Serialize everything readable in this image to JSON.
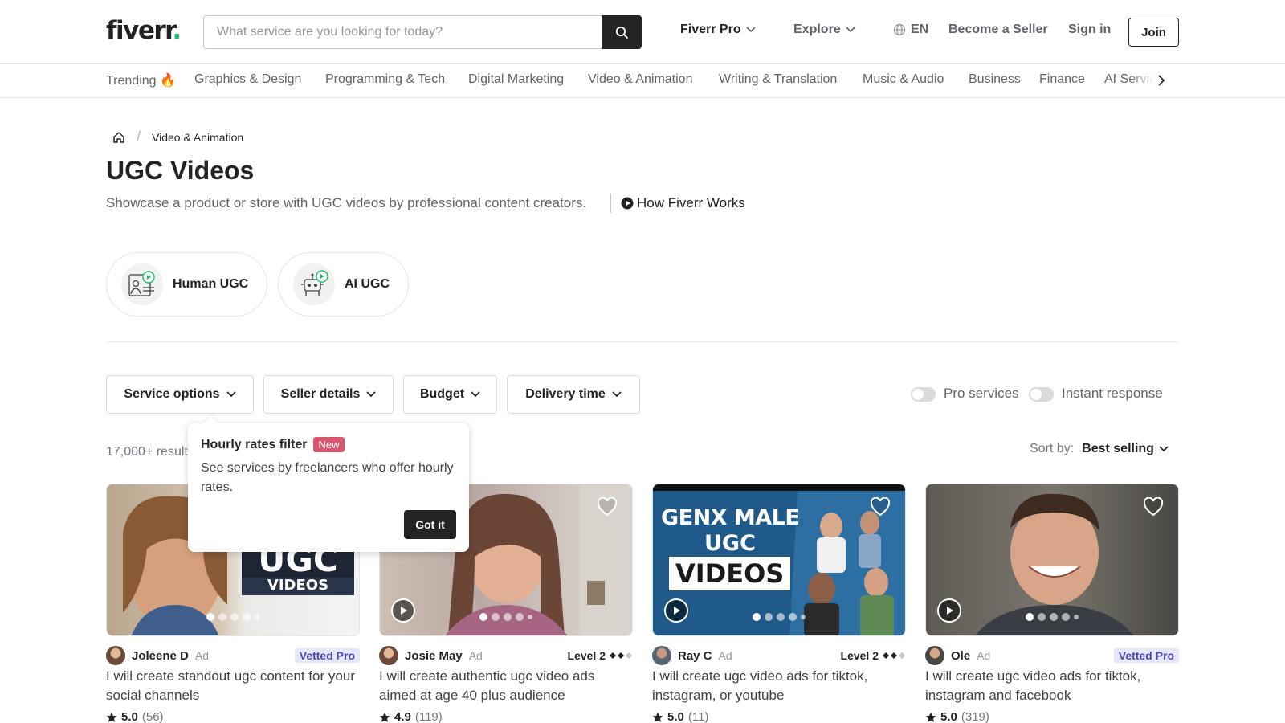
{
  "header": {
    "logo_text": "fiverr",
    "logo_dot": ".",
    "search_placeholder": "What service are you looking for today?",
    "nav": {
      "fiverr_pro": "Fiverr Pro",
      "explore": "Explore",
      "language": "EN",
      "become_seller": "Become a Seller",
      "sign_in": "Sign in",
      "join": "Join"
    }
  },
  "categories": [
    "Trending 🔥",
    "Graphics & Design",
    "Programming & Tech",
    "Digital Marketing",
    "Video & Animation",
    "Writing & Translation",
    "Music & Audio",
    "Business",
    "Finance",
    "AI Servic"
  ],
  "breadcrumb": {
    "current": "Video & Animation"
  },
  "page": {
    "title": "UGC Videos",
    "subtitle": "Showcase a product or store with UGC videos by professional content creators.",
    "how_works": "How Fiverr Works"
  },
  "subcategories": [
    "Human UGC",
    "AI UGC"
  ],
  "filters": {
    "service_options": "Service options",
    "seller_details": "Seller details",
    "budget": "Budget",
    "delivery_time": "Delivery time",
    "pro_services": "Pro services",
    "instant_response": "Instant response"
  },
  "results": {
    "count_text": "17,000+ result",
    "sort_label": "Sort by:",
    "sort_value": "Best selling"
  },
  "popover": {
    "title": "Hourly rates filter",
    "badge": "New",
    "text": "See services by freelancers who offer hourly rates.",
    "button": "Got it"
  },
  "gigs": [
    {
      "seller": "Joleene D",
      "ad": "Ad",
      "badge": "Vetted Pro",
      "title": "I will create standout ugc content for your social channels",
      "rating": "5.0",
      "reviews": "(56)",
      "overlay_text": "UGC",
      "overlay_sub": "VIDEOS"
    },
    {
      "seller": "Josie May",
      "ad": "Ad",
      "badge": "Level 2",
      "title": "I will create authentic ugc video ads aimed at age 40 plus audience",
      "rating": "4.9",
      "reviews": "(119)"
    },
    {
      "seller": "Ray C",
      "ad": "Ad",
      "badge": "Level 2",
      "title": "I will create ugc video ads for tiktok, instagram, or youtube",
      "rating": "5.0",
      "reviews": "(11)",
      "overlay_lines": [
        "GENX MALE",
        "UGC",
        "VIDEOS"
      ]
    },
    {
      "seller": "Ole",
      "ad": "Ad",
      "badge": "Vetted Pro",
      "title": "I will create ugc video ads for tiktok, instagram and facebook",
      "rating": "5.0",
      "reviews": "(319)"
    }
  ],
  "colors": {
    "brand_green": "#1dbf73",
    "dark": "#222325",
    "new_badge": "#d8576f",
    "vetted_text": "#4f46b8"
  }
}
